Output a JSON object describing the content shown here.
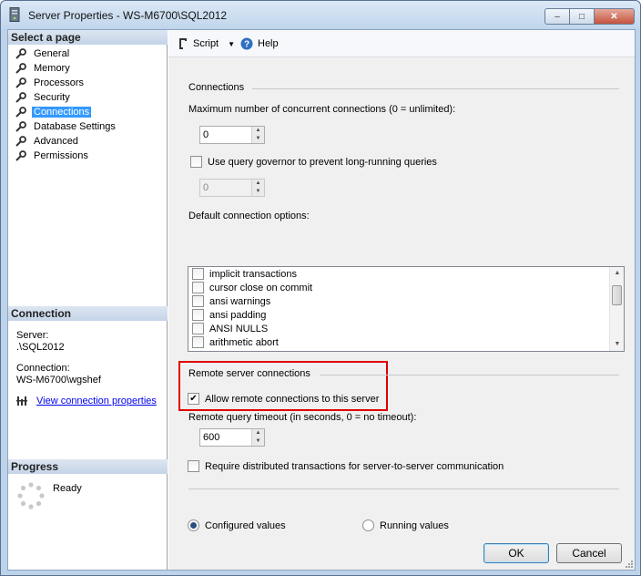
{
  "window": {
    "title": "Server Properties - WS-M6700\\SQL2012",
    "min_label": "‒",
    "max_label": "□",
    "close_label": "✕"
  },
  "left": {
    "select_page_header": "Select a page",
    "pages": [
      {
        "label": "General",
        "icon": "wrench-icon"
      },
      {
        "label": "Memory",
        "icon": "wrench-icon"
      },
      {
        "label": "Processors",
        "icon": "wrench-icon"
      },
      {
        "label": "Security",
        "icon": "wrench-icon"
      },
      {
        "label": "Connections",
        "icon": "wrench-icon",
        "selected": true
      },
      {
        "label": "Database Settings",
        "icon": "wrench-icon"
      },
      {
        "label": "Advanced",
        "icon": "wrench-icon"
      },
      {
        "label": "Permissions",
        "icon": "wrench-icon"
      }
    ],
    "connection_header": "Connection",
    "server_label": "Server:",
    "server_value": ".\\SQL2012",
    "connection_label": "Connection:",
    "connection_value": "WS-M6700\\wgshef",
    "view_connection_link": "View connection properties",
    "progress_header": "Progress",
    "progress_status": "Ready"
  },
  "toolbar": {
    "script_label": "Script",
    "help_label": "Help"
  },
  "connections": {
    "group_label": "Connections",
    "max_concurrent_label": "Maximum number of concurrent connections (0 = unlimited):",
    "max_concurrent_value": "0",
    "query_governor_label": "Use query governor to prevent long-running queries",
    "query_governor_checked": false,
    "query_governor_value": "0",
    "default_options_label": "Default connection options:",
    "default_options": [
      {
        "label": "implicit transactions",
        "checked": false
      },
      {
        "label": "cursor close on commit",
        "checked": false
      },
      {
        "label": "ansi warnings",
        "checked": false
      },
      {
        "label": "ansi padding",
        "checked": false
      },
      {
        "label": "ANSI NULLS",
        "checked": false
      },
      {
        "label": "arithmetic abort",
        "checked": false
      }
    ]
  },
  "remote": {
    "group_label": "Remote server connections",
    "allow_label": "Allow remote connections to this server",
    "allow_checked": true,
    "timeout_label": "Remote query timeout (in seconds, 0 = no timeout):",
    "timeout_value": "600",
    "distributed_label": "Require distributed transactions for server-to-server communication",
    "distributed_checked": false
  },
  "values_radio": {
    "configured_label": "Configured values",
    "running_label": "Running values",
    "selected": "configured"
  },
  "buttons": {
    "ok_label": "OK",
    "cancel_label": "Cancel"
  },
  "colors": {
    "selection": "#3399ff",
    "highlight_box": "#e00000",
    "link": "#0000ee"
  }
}
